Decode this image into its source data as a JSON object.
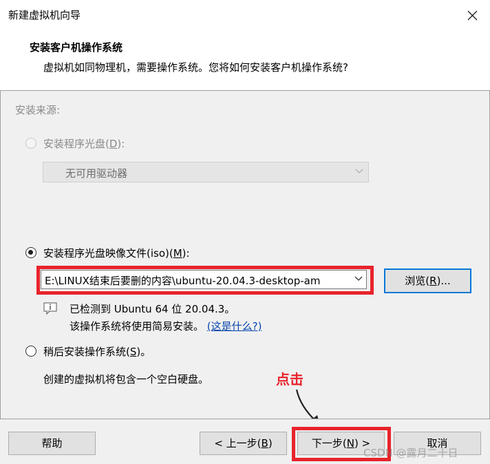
{
  "window": {
    "title": "新建虚拟机向导",
    "close_glyph": "✕"
  },
  "header": {
    "title": "安装客户机操作系统",
    "description": "虚拟机如同物理机，需要操作系统。您将如何安装客户机操作系统?"
  },
  "install_source": {
    "label": "安装来源:",
    "disc_option": {
      "text_before": "安装程序光盘(",
      "mnemonic": "D",
      "text_after": "):",
      "selected": false,
      "enabled": false
    },
    "disc_combo": {
      "value": "无可用驱动器"
    },
    "iso_option": {
      "text_before": "安装程序光盘映像文件(iso)(",
      "mnemonic": "M",
      "text_after": "):",
      "selected": true
    },
    "iso_path": {
      "value": "E:\\LINUX结束后要删的内容\\ubuntu-20.04.3-desktop-am"
    },
    "browse_button": {
      "text_before": "浏览(",
      "mnemonic": "R",
      "text_after": ")..."
    },
    "detect_info": {
      "line1": "已检测到 Ubuntu 64 位 20.04.3。",
      "line2": "该操作系统将使用简易安装。",
      "link": "(这是什么?)"
    },
    "later_option": {
      "text_before": "稍后安装操作系统(",
      "mnemonic": "S",
      "text_after": ")。",
      "selected": false
    },
    "later_info": "创建的虚拟机将包含一个空白硬盘。"
  },
  "annotation": {
    "text": "点击",
    "color": "#e8232b"
  },
  "footer": {
    "help_button": "帮助",
    "back_button": {
      "text_before": "< 上一步(",
      "mnemonic": "B",
      "text_after": ")"
    },
    "next_button": {
      "text_before": "下一步(",
      "mnemonic": "N",
      "text_after": ") >"
    },
    "cancel_button": "取消"
  },
  "watermark": "CSDN @露月二十日",
  "colors": {
    "accent_focus": "#0078d7",
    "highlight": "#e8232b",
    "link": "#0645ad"
  }
}
